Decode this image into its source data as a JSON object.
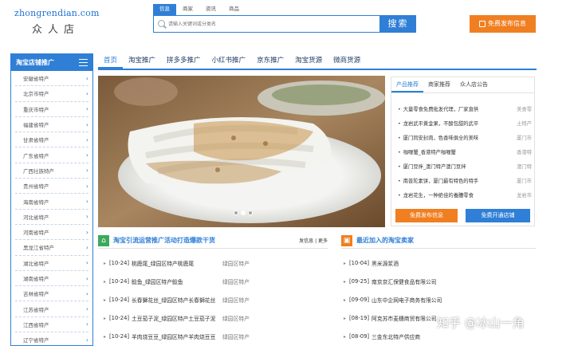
{
  "header": {
    "logo_url": "zhongrendian.com",
    "logo_name": "众人店",
    "search_tabs": [
      "信息",
      "商家",
      "资讯",
      "商品"
    ],
    "search_placeholder": "请输入关键词或分类名",
    "search_button": "搜索",
    "publish_button": "免费发布信息"
  },
  "sidebar": {
    "title": "淘宝店铺推广",
    "items": [
      "安徽省特产",
      "北京市特产",
      "重庆市特产",
      "福建省特产",
      "甘肃省特产",
      "广东省特产",
      "广西壮族特产",
      "贵州省特产",
      "海南省特产",
      "河北省特产",
      "河南省特产",
      "黑龙江省特产",
      "湖北省特产",
      "湖南省特产",
      "吉林省特产",
      "江苏省特产",
      "江西省特产",
      "辽宁省特产"
    ]
  },
  "nav": [
    "首页",
    "淘宝推广",
    "拼多多推广",
    "小红书推广",
    "京东推广",
    "淘宝货源",
    "微商货源"
  ],
  "banner": {
    "dots": 3,
    "active_dot": 1
  },
  "panel": {
    "tabs": [
      "产品推荐",
      "商家推荐",
      "众人店公告"
    ],
    "items": [
      {
        "title": "大量零食免费批发代理，厂家直供",
        "source": "美食零"
      },
      {
        "title": "龙岩武平黄金果，不酸包甜的武平",
        "source": "土特产"
      },
      {
        "title": "厦门同安封肉，色香味俱全的美味",
        "source": "厦门市"
      },
      {
        "title": "咖喱蟹_香港特产咖喱蟹",
        "source": "香港特"
      },
      {
        "title": "厦门豆拌_澳门特产澳门豆拌",
        "source": "澳门特"
      },
      {
        "title": "南普陀素饼，厦门最有特色的特手",
        "source": "厦门市"
      },
      {
        "title": "龙岩花生，一种绝佳的養體零食",
        "source": "龙岩市"
      }
    ],
    "btn_publish": "免费发布信息",
    "btn_shop": "免费开通店铺"
  },
  "section_left": {
    "title": "淘宝引流运营推广活动打造爆款干货",
    "more": "发信息 | 更多",
    "rows": [
      {
        "date": "[10-24]",
        "title": "桃鹿尾_绿园区特产桃鹿尾",
        "cat": "绿园区特产"
      },
      {
        "date": "[10-24]",
        "title": "鲶鱼_绿园区特产鲶鱼",
        "cat": "绿园区特产"
      },
      {
        "date": "[10-24]",
        "title": "长春獅花丝_绿园区特产长春獅花丝",
        "cat": "绿园区特产"
      },
      {
        "date": "[10-24]",
        "title": "土豆茄子泥_绿园区特产土豆茄子泥",
        "cat": "绿园区特产"
      },
      {
        "date": "[10-24]",
        "title": "羊肉烧豆豆_绿园区特产羊肉烧豆豆",
        "cat": "绿园区特产"
      }
    ]
  },
  "section_right": {
    "title": "最近加入的淘宝卖家",
    "rows": [
      {
        "date": "[10-04]",
        "title": "黑米源浆酒"
      },
      {
        "date": "[09-25]",
        "title": "南京京汇保健食品有限公司"
      },
      {
        "date": "[09-09]",
        "title": "山东中企网电子商务有限公司"
      },
      {
        "date": "[08-19]",
        "title": "阿克苏市麦穗商贸有限公司"
      },
      {
        "date": "[08-09]",
        "title": "三金东北特产供应商"
      }
    ]
  },
  "watermark": "知乎 @冰山一角",
  "colors": {
    "primary": "#2f7fd6",
    "orange": "#f07f21",
    "green": "#3caa5a"
  }
}
